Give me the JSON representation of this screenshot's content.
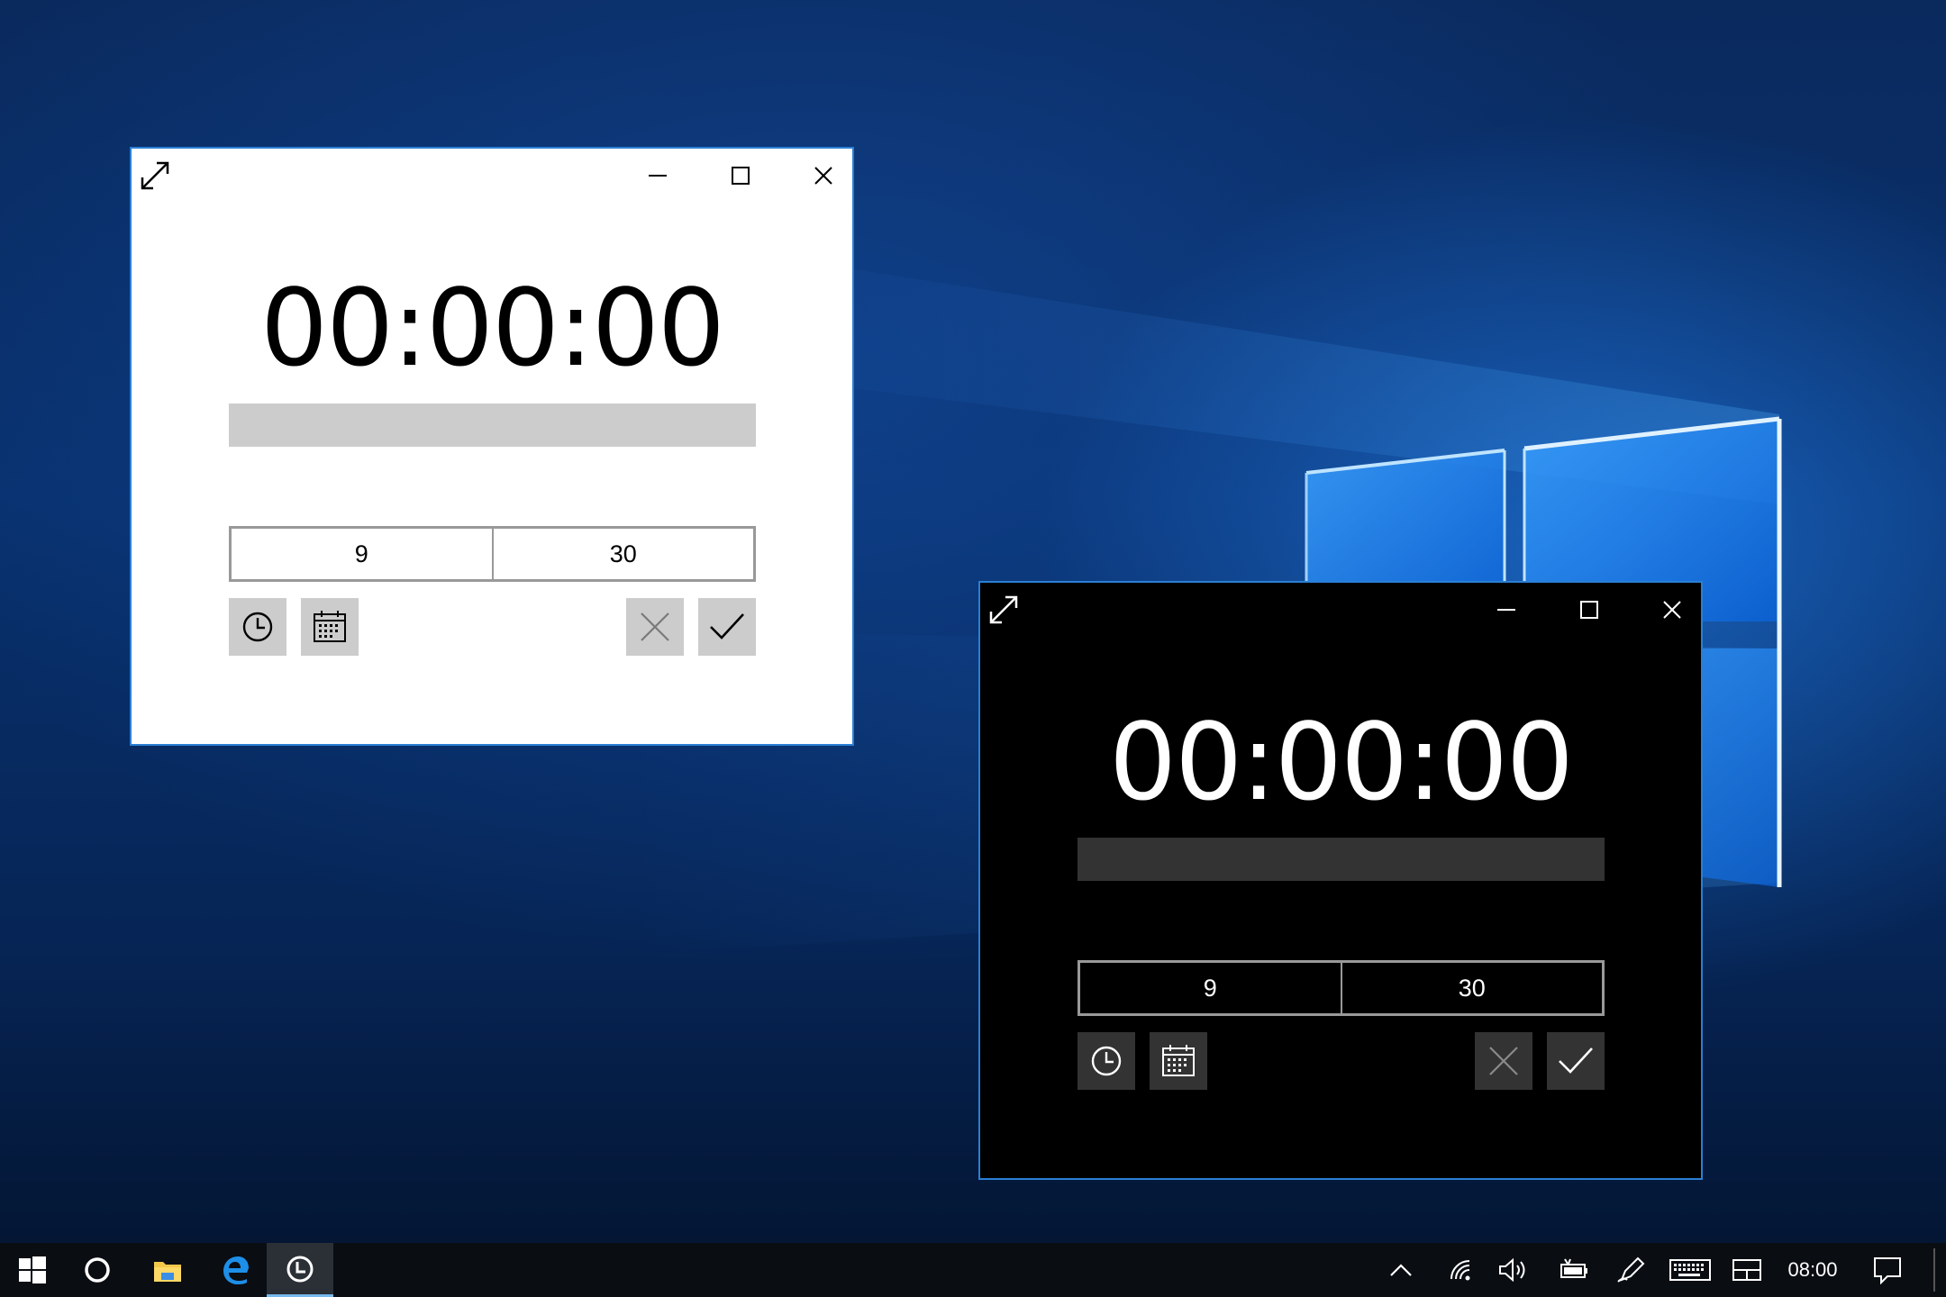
{
  "desktop": {
    "wallpaper": "windows-10-hero",
    "accent": "#2a7fd4"
  },
  "windows": [
    {
      "theme": "light",
      "title_buttons": [
        "minimize",
        "maximize",
        "close"
      ],
      "time_display": "00:00:00",
      "progress_fraction": 0,
      "hour_value": "9",
      "minute_value": "30",
      "buttons": {
        "time_picker": "clock-icon",
        "date_picker": "calendar-icon",
        "cancel": "close-icon",
        "accept": "check-icon"
      }
    },
    {
      "theme": "dark",
      "title_buttons": [
        "minimize",
        "maximize",
        "close"
      ],
      "time_display": "00:00:00",
      "progress_fraction": 0,
      "hour_value": "9",
      "minute_value": "30",
      "buttons": {
        "time_picker": "clock-icon",
        "date_picker": "calendar-icon",
        "cancel": "close-icon",
        "accept": "check-icon"
      }
    }
  ],
  "taskbar": {
    "pinned": [
      "windows-start-icon",
      "cortana-icon",
      "file-explorer-icon",
      "edge-icon",
      "alarm-app-icon"
    ],
    "active_app": "alarm-app-icon",
    "tray_icons": [
      "chevron-up-icon",
      "wifi-icon",
      "volume-icon",
      "battery-icon",
      "pen-icon",
      "touch-keyboard-icon",
      "tablet-mode-icon"
    ],
    "clock": "08:00",
    "notification_icon": "action-center-icon"
  }
}
